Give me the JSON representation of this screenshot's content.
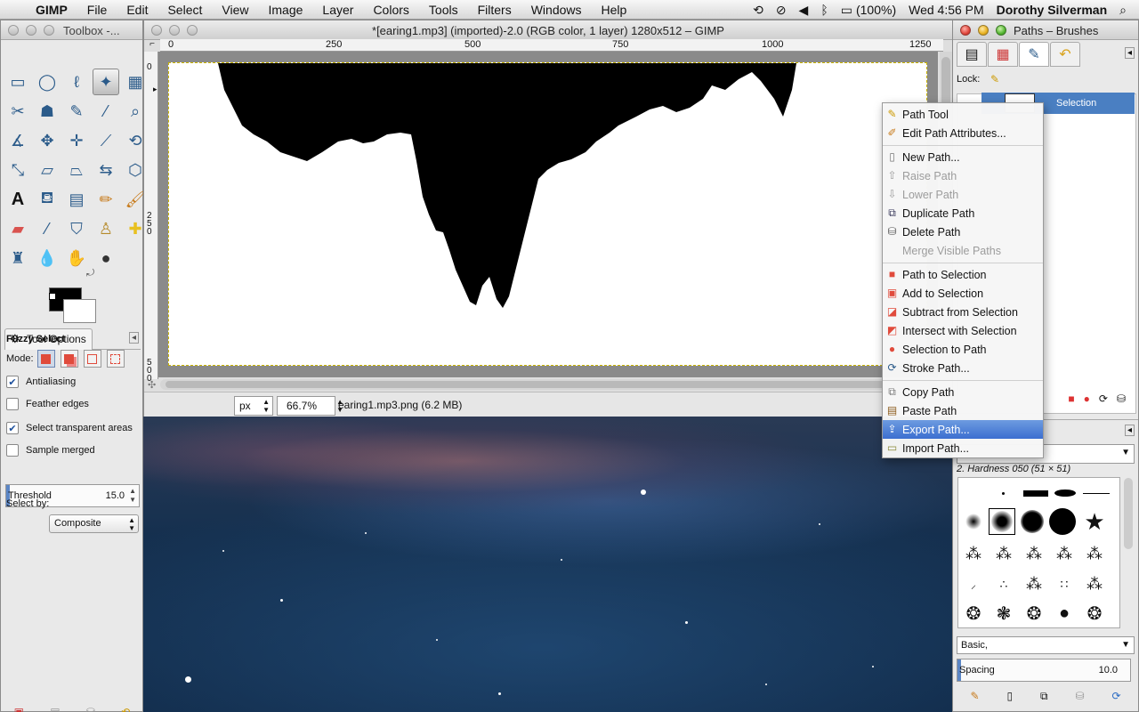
{
  "menubar": {
    "app": "GIMP",
    "items": [
      "File",
      "Edit",
      "Select",
      "View",
      "Image",
      "Layer",
      "Colors",
      "Tools",
      "Filters",
      "Windows",
      "Help"
    ],
    "battery": "(100%)",
    "clock": "Wed 4:56 PM",
    "user": "Dorothy Silverman"
  },
  "toolbox": {
    "title": "Toolbox -...",
    "options_tab": "Tool Options",
    "tool_name": "Fuzzy Select",
    "mode_label": "Mode:",
    "antialiasing": "Antialiasing",
    "feather_edges": "Feather edges",
    "select_transparent": "Select transparent areas",
    "sample_merged": "Sample merged",
    "threshold_label": "Threshold",
    "threshold_value": "15.0",
    "select_by_label": "Select by:",
    "select_by_value": "Composite"
  },
  "image_window": {
    "title": "*[earing1.mp3] (imported)-2.0 (RGB color, 1 layer) 1280x512 – GIMP",
    "ruler_h": [
      "0",
      "250",
      "500",
      "750",
      "1000",
      "1250"
    ],
    "ruler_v": [
      "0",
      "250",
      "500"
    ],
    "unit": "px",
    "zoom": "66.7%",
    "file_info": "earing1.mp3.png (6.2 MB)"
  },
  "dock": {
    "title": "Paths – Brushes",
    "lock_label": "Lock:",
    "path_name": "Selection",
    "brush_name": "2. Hardness 050 (51 × 51)",
    "brush_preset": "Basic,",
    "spacing_label": "Spacing",
    "spacing_value": "10.0"
  },
  "context_menu": {
    "items": [
      {
        "label": "Path Tool",
        "icon": "pen"
      },
      {
        "label": "Edit Path Attributes...",
        "icon": "edit"
      },
      {
        "label": "New Path...",
        "icon": "new"
      },
      {
        "label": "Raise Path",
        "icon": "up"
      },
      {
        "label": "Lower Path",
        "icon": "down"
      },
      {
        "label": "Duplicate Path",
        "icon": "dup"
      },
      {
        "label": "Delete Path",
        "icon": "trash"
      },
      {
        "label": "Merge Visible Paths",
        "icon": ""
      },
      {
        "label": "Path to Selection",
        "icon": "sel"
      },
      {
        "label": "Add to Selection",
        "icon": "add"
      },
      {
        "label": "Subtract from Selection",
        "icon": "sub"
      },
      {
        "label": "Intersect with Selection",
        "icon": "int"
      },
      {
        "label": "Selection to Path",
        "icon": "s2p"
      },
      {
        "label": "Stroke Path...",
        "icon": "stroke"
      },
      {
        "label": "Copy Path",
        "icon": "copy"
      },
      {
        "label": "Paste Path",
        "icon": "paste"
      },
      {
        "label": "Export Path...",
        "icon": "export"
      },
      {
        "label": "Import Path...",
        "icon": "import"
      }
    ]
  }
}
